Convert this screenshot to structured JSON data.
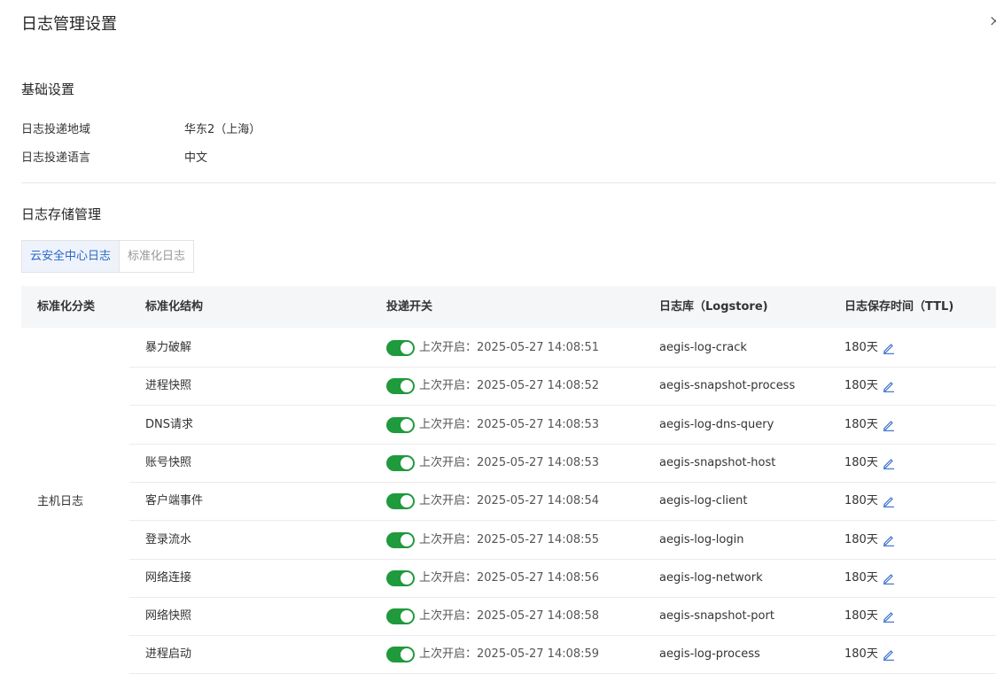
{
  "dialog": {
    "title": "日志管理设置",
    "close_glyph": "×"
  },
  "basic": {
    "section_title": "基础设置",
    "region_label": "日志投递地域",
    "region_value": "华东2（上海）",
    "language_label": "日志投递语言",
    "language_value": "中文"
  },
  "storage": {
    "section_title": "日志存储管理",
    "tabs": [
      {
        "label": "云安全中心日志",
        "active": true
      },
      {
        "label": "标准化日志",
        "active": false
      }
    ]
  },
  "table": {
    "headers": {
      "category": "标准化分类",
      "structure": "标准化结构",
      "switch": "投递开关",
      "logstore": "日志库（Logstore)",
      "ttl": "日志保存时间（TTL)"
    },
    "category": "主机日志",
    "rows": [
      {
        "structure": "暴力破解",
        "status": "上次开启：2025-05-27 14:08:51",
        "logstore": "aegis-log-crack",
        "ttl": "180天",
        "enabled": true
      },
      {
        "structure": "进程快照",
        "status": "上次开启：2025-05-27 14:08:52",
        "logstore": "aegis-snapshot-process",
        "ttl": "180天",
        "enabled": true
      },
      {
        "structure": "DNS请求",
        "status": "上次开启：2025-05-27 14:08:53",
        "logstore": "aegis-log-dns-query",
        "ttl": "180天",
        "enabled": true
      },
      {
        "structure": "账号快照",
        "status": "上次开启：2025-05-27 14:08:53",
        "logstore": "aegis-snapshot-host",
        "ttl": "180天",
        "enabled": true
      },
      {
        "structure": "客户端事件",
        "status": "上次开启：2025-05-27 14:08:54",
        "logstore": "aegis-log-client",
        "ttl": "180天",
        "enabled": true
      },
      {
        "structure": "登录流水",
        "status": "上次开启：2025-05-27 14:08:55",
        "logstore": "aegis-log-login",
        "ttl": "180天",
        "enabled": true
      },
      {
        "structure": "网络连接",
        "status": "上次开启：2025-05-27 14:08:56",
        "logstore": "aegis-log-network",
        "ttl": "180天",
        "enabled": true
      },
      {
        "structure": "网络快照",
        "status": "上次开启：2025-05-27 14:08:58",
        "logstore": "aegis-snapshot-port",
        "ttl": "180天",
        "enabled": true
      },
      {
        "structure": "进程启动",
        "status": "上次开启：2025-05-27 14:08:59",
        "logstore": "aegis-log-process",
        "ttl": "180天",
        "enabled": true
      }
    ]
  },
  "colors": {
    "toggle_on": "#1f9a3c",
    "accent": "#2a66c8",
    "header_bg": "#f4f6f8"
  },
  "icons": {
    "edit": "edit-icon",
    "close": "close-icon"
  }
}
